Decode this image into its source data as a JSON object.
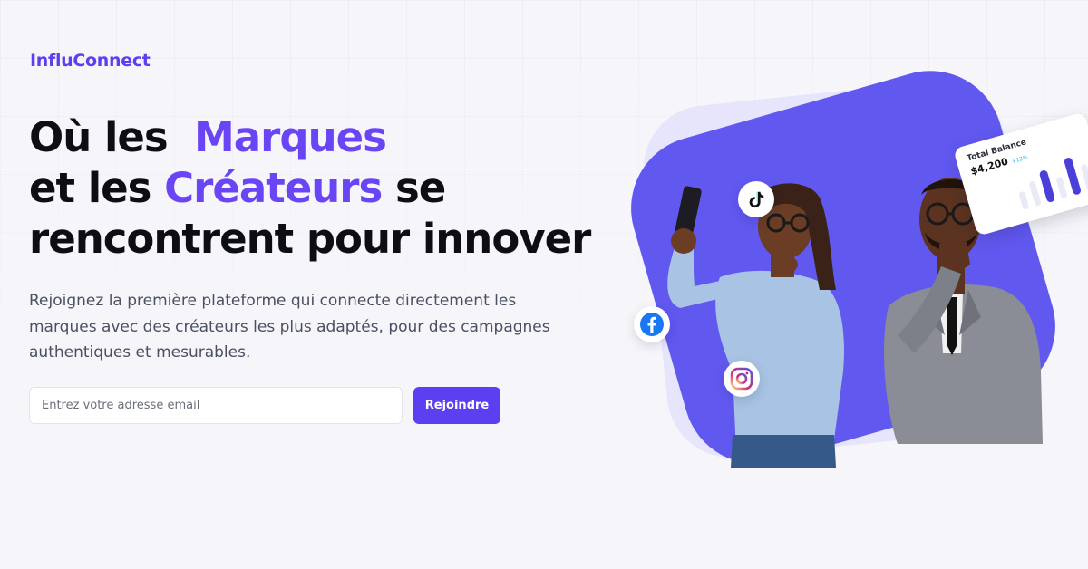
{
  "brand": {
    "name": "InfluConnect",
    "accent": "#5b3ff0"
  },
  "hero": {
    "line1_pre": "Où les",
    "line1_accent": "Marques",
    "line2_pre": "et les",
    "line2_accent": "Créateurs",
    "line2_post": "se",
    "line3": "rencontrent pour innover",
    "subtitle": "Rejoignez la première plateforme qui connecte directement les marques avec des créateurs les plus adaptés, pour des campagnes authentiques et mesurables."
  },
  "form": {
    "email_placeholder": "Entrez votre adresse email",
    "email_value": "",
    "submit_label": "Rejoindre"
  },
  "card": {
    "label": "Total Balance",
    "amount": "$4,200",
    "change": "+12%"
  },
  "icons": {
    "tiktok": "tiktok-icon",
    "facebook": "facebook-icon",
    "instagram": "instagram-icon"
  },
  "colors": {
    "background": "#f6f6fa",
    "headline": "#0d0d14",
    "accent_text": "#6a45f5",
    "hero_blob": "#6158f0",
    "button": "#5b3ff0"
  }
}
